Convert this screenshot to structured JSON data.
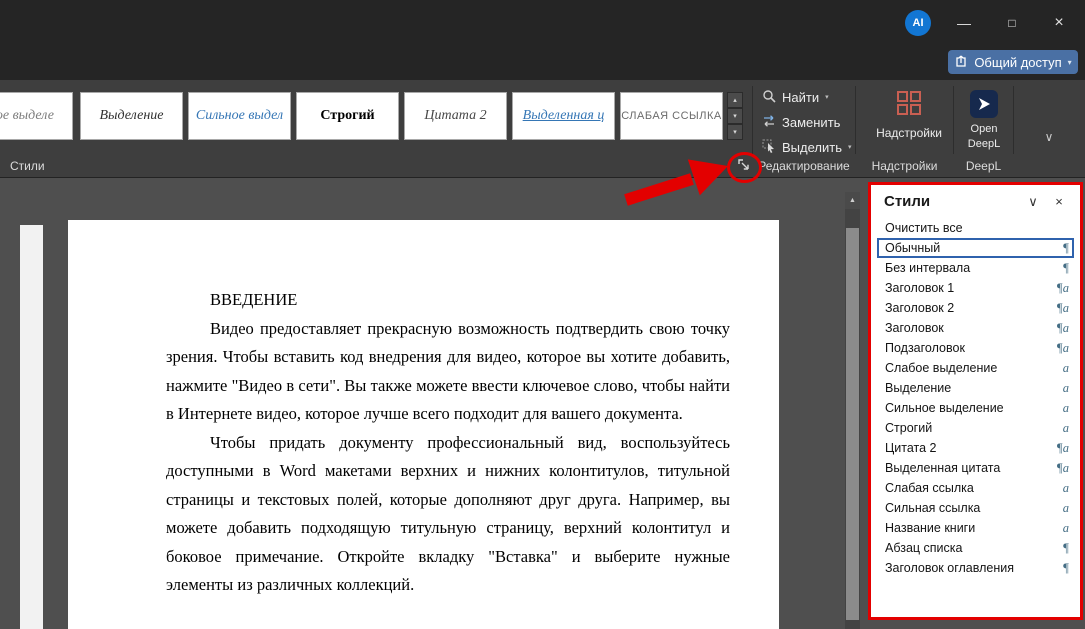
{
  "titlebar": {
    "avatar_label": "AI",
    "share_button": "Общий доступ"
  },
  "icons": {
    "minimize": "—",
    "maximize": "□",
    "close": "×",
    "chevron_down": "▾",
    "chevron_up": "▴",
    "gallery_more": "▾",
    "ribbon_collapse": "∨",
    "pane_chevron": "∨",
    "pane_close": "×",
    "scroll_up": "▲"
  },
  "colors": {
    "annotation_red": "#e30000",
    "selection_blue": "#2f62ad",
    "share_button_blue": "#4a70a4",
    "deepl_navy": "#16294d",
    "addins_grid_red": "#c95f52",
    "avatar_blue": "#1276d3"
  },
  "ribbon": {
    "style_gallery": [
      {
        "label": "бое выделе"
      },
      {
        "label": "Выделение"
      },
      {
        "label": "Сильное выдел"
      },
      {
        "label": "Строгий"
      },
      {
        "label": "Цитата 2"
      },
      {
        "label": "Выделенная ц"
      },
      {
        "label": "СЛАБАЯ ССЫЛКА"
      }
    ],
    "editing": {
      "find": "Найти",
      "replace": "Заменить",
      "select": "Выделить"
    },
    "addins_button": "Надстройки",
    "deepl_button_line1": "Open",
    "deepl_button_line2": "DeepL",
    "groups": {
      "styles_label": "Стили",
      "editing_label": "Редактирование",
      "addins_label": "Надстройки",
      "deepl_label": "DeepL"
    }
  },
  "document": {
    "heading": "ВВЕДЕНИЕ",
    "paragraphs": [
      "Видео предоставляет прекрасную возможность подтвердить свою точку зрения. Чтобы вставить код внедрения для видео, которое вы хотите добавить, нажмите \"Видео в сети\". Вы также можете ввести ключевое слово, чтобы найти в Интернете видео, которое лучше всего подходит для вашего документа.",
      "Чтобы придать документу профессиональный вид, воспользуйтесь доступными в Word макетами верхних и нижних колонтитулов, титульной страницы и текстовых полей, которые дополняют друг друга. Например, вы можете добавить подходящую титульную страницу, верхний колонтитул и боковое примечание. Откройте вкладку \"Вставка\" и выберите нужные элементы из различных коллекций."
    ]
  },
  "styles_pane": {
    "title": "Стили",
    "items": [
      {
        "label": "Очистить все",
        "marker": ""
      },
      {
        "label": "Обычный",
        "marker": "¶",
        "selected": true
      },
      {
        "label": "Без интервала",
        "marker": "¶"
      },
      {
        "label": "Заголовок 1",
        "marker": "¶a"
      },
      {
        "label": "Заголовок 2",
        "marker": "¶a"
      },
      {
        "label": "Заголовок",
        "marker": "¶a"
      },
      {
        "label": "Подзаголовок",
        "marker": "¶a"
      },
      {
        "label": "Слабое выделение",
        "marker": "a"
      },
      {
        "label": "Выделение",
        "marker": "a"
      },
      {
        "label": "Сильное выделение",
        "marker": "a"
      },
      {
        "label": "Строгий",
        "marker": "a"
      },
      {
        "label": "Цитата 2",
        "marker": "¶a"
      },
      {
        "label": "Выделенная цитата",
        "marker": "¶a"
      },
      {
        "label": "Слабая ссылка",
        "marker": "a"
      },
      {
        "label": "Сильная ссылка",
        "marker": "a"
      },
      {
        "label": "Название книги",
        "marker": "a"
      },
      {
        "label": "Абзац списка",
        "marker": "¶"
      },
      {
        "label": "Заголовок оглавления",
        "marker": "¶"
      }
    ]
  }
}
